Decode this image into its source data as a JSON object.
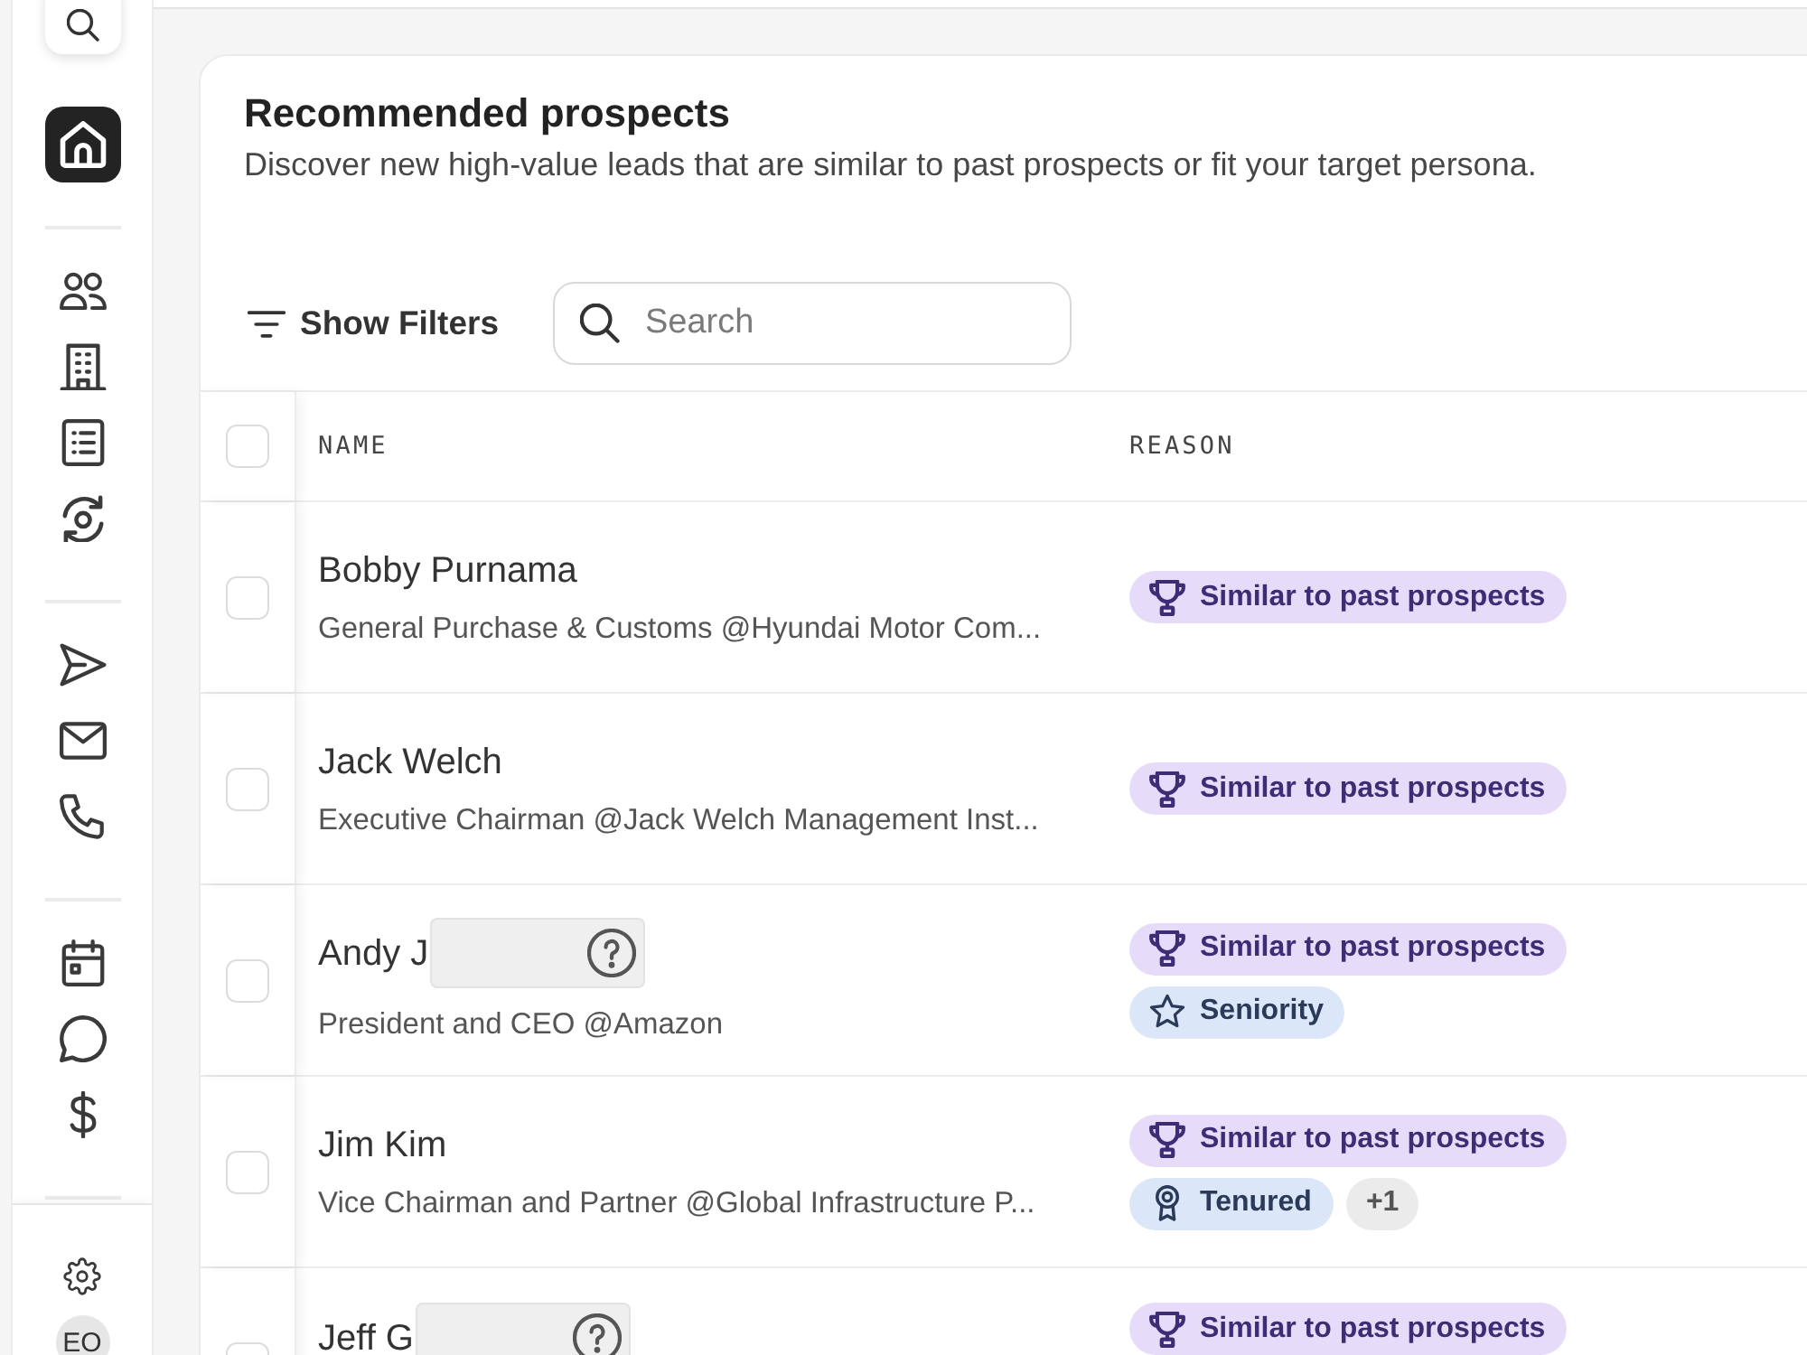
{
  "sidebar": {
    "groups": [
      [
        {
          "selected": true
        }
      ],
      [
        {
          "selected": false
        },
        {
          "selected": false
        },
        {
          "selected": false
        },
        {
          "selected": false
        }
      ],
      [
        {
          "selected": false
        },
        {
          "selected": false
        },
        {
          "selected": false
        }
      ],
      [
        {
          "selected": false
        },
        {
          "selected": false
        },
        {
          "selected": false
        }
      ]
    ],
    "avatar": {
      "initials": "EO"
    }
  },
  "header": {
    "title": "Recommended prospects",
    "subtitle": "Discover new high-value leads that are similar to past prospects or fit your target persona."
  },
  "toolbar": {
    "filter_button": {
      "label": "Show Filters"
    },
    "search": {
      "placeholder": "Search"
    }
  },
  "table": {
    "select_all": {
      "checked": false
    },
    "columns": [
      "NAME",
      "REASON"
    ],
    "rows": [
      {
        "checked": false,
        "name": "Bobby Purnama",
        "masked": false,
        "title": "General Purchase & Customs @Hyundai Motor Com...",
        "tags": [
          {
            "kind": "similar",
            "label": "Similar to past prospects"
          }
        ]
      },
      {
        "checked": false,
        "name": "Jack Welch",
        "masked": false,
        "title": "Executive Chairman @Jack Welch Management Inst...",
        "tags": [
          {
            "kind": "similar",
            "label": "Similar to past prospects"
          }
        ]
      },
      {
        "checked": false,
        "name": "Andy J",
        "masked": true,
        "title": "President and CEO @Amazon",
        "tags": [
          {
            "kind": "similar",
            "label": "Similar to past prospects"
          },
          {
            "kind": "seniority",
            "label": "Seniority"
          }
        ]
      },
      {
        "checked": false,
        "name": "Jim Kim",
        "masked": false,
        "title": "Vice Chairman and Partner @Global Infrastructure P...",
        "tags": [
          {
            "kind": "similar",
            "label": "Similar to past prospects"
          },
          {
            "kind": "tenured",
            "label": "Tenured"
          },
          {
            "kind": "more",
            "label": "+1"
          }
        ]
      },
      {
        "checked": false,
        "name": "Jeff G",
        "masked": true,
        "tags": [
          {
            "kind": "similar",
            "label": "Similar to past prospects"
          }
        ]
      }
    ]
  }
}
